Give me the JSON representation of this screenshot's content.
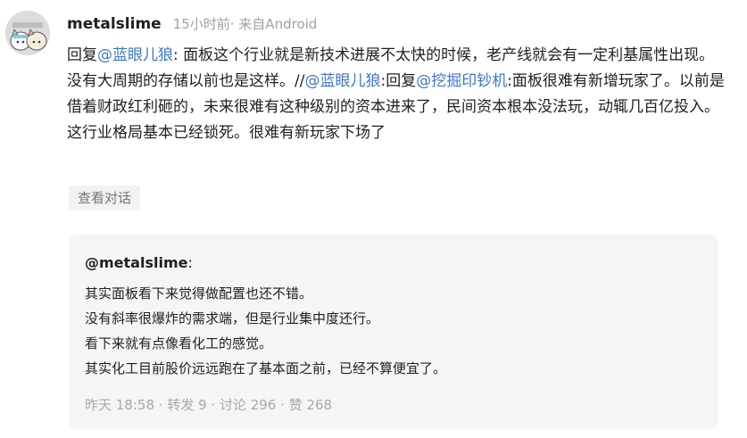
{
  "post": {
    "username": "metalslime",
    "meta": "15小时前· 来自Android",
    "lines": [
      {
        "reply_prefix": "回复",
        "mention": "@蓝眼儿狼",
        "text": ": 面板这个行业就是新技术进展不太快的时候，老产线就会有一定利基属性出现。"
      },
      {
        "text1": "没有大周期的存储以前也是这样。//",
        "mention1": "@蓝眼儿狼",
        "text2": ":回复",
        "mention2": "@挖掘印钞机",
        "text3": ":面板很难有新增玩家了。以前是借着财政红利砸的，未来很难有这种级别的资本进来了，民间资本根本没法玩，动辄几百亿投入。这行业格局基本已经锁死。很难有新玩家下场了"
      }
    ],
    "view_conversation": "查看对话"
  },
  "quote": {
    "author": "@metalslime",
    "colon": ":",
    "lines": [
      "其实面板看下来觉得做配置也还不错。",
      "没有斜率很爆炸的需求端，但是行业集中度还行。",
      "看下来就有点像看化工的感觉。",
      "其实化工目前股价远远跑在了基本面之前，已经不算便宜了。"
    ],
    "footer": {
      "time": "昨天 18:58",
      "repost": "转发 9",
      "comment": "讨论 296",
      "like": "赞 268",
      "sep": " · "
    }
  },
  "colors": {
    "mention": "#3c78c8",
    "meta": "#a0a0a0",
    "quote_bg": "#f5f5f7"
  },
  "icons": {
    "avatar": "cartoon-cats-avatar"
  }
}
